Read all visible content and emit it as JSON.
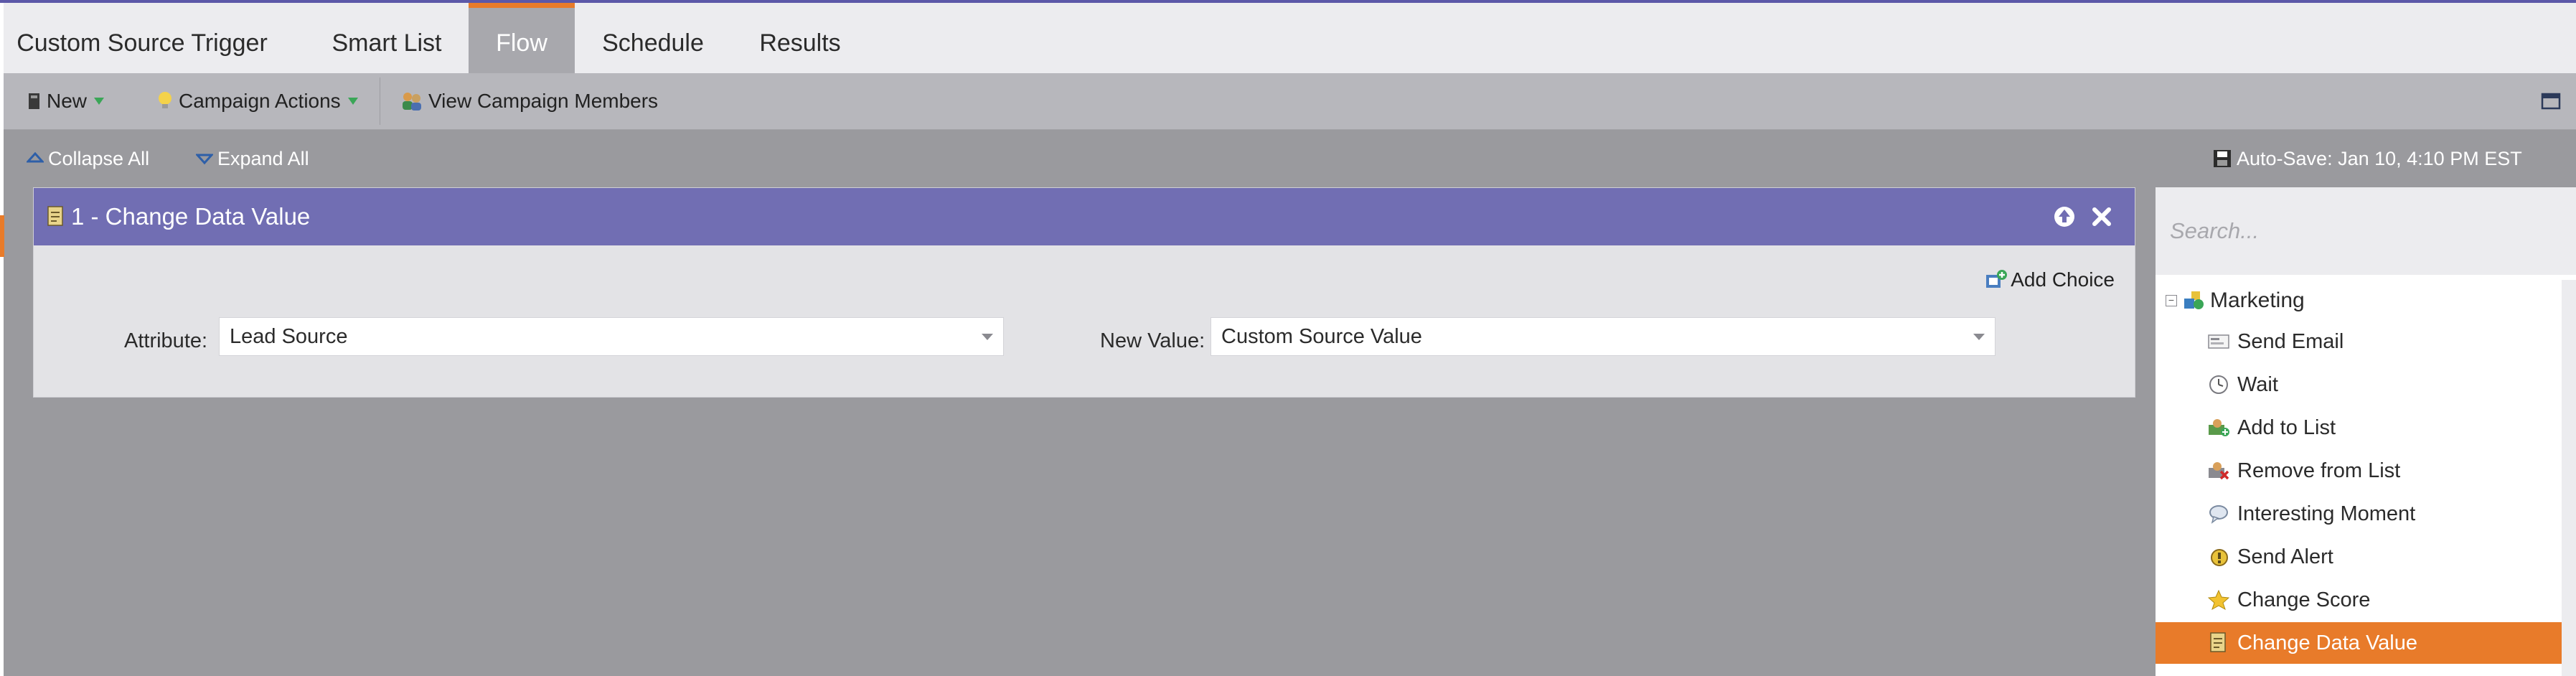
{
  "tabs": [
    {
      "label": "Custom Source Trigger",
      "active": false
    },
    {
      "label": "Smart List",
      "active": false
    },
    {
      "label": "Flow",
      "active": true
    },
    {
      "label": "Schedule",
      "active": false
    },
    {
      "label": "Results",
      "active": false
    }
  ],
  "toolbar": {
    "new_label": "New",
    "campaign_actions_label": "Campaign Actions",
    "view_members_label": "View Campaign Members"
  },
  "actionbar": {
    "collapse_all": "Collapse All",
    "expand_all": "Expand All",
    "autosave": "Auto-Save: Jan 10, 4:10 PM EST"
  },
  "step": {
    "title": "1 - Change Data Value",
    "add_choice": "Add Choice",
    "attribute_label": "Attribute:",
    "attribute_value": "Lead Source",
    "new_value_label": "New Value:",
    "new_value_value": "Custom Source Value"
  },
  "palette": {
    "search_placeholder": "Search...",
    "group_label": "Marketing",
    "items": [
      {
        "label": "Send Email",
        "icon": "email-icon"
      },
      {
        "label": "Wait",
        "icon": "clock-icon"
      },
      {
        "label": "Add to List",
        "icon": "add-to-list-icon"
      },
      {
        "label": "Remove from List",
        "icon": "remove-from-list-icon"
      },
      {
        "label": "Interesting Moment",
        "icon": "speech-bubble-icon"
      },
      {
        "label": "Send Alert",
        "icon": "alert-icon"
      },
      {
        "label": "Change Score",
        "icon": "star-icon"
      },
      {
        "label": "Change Data Value",
        "icon": "data-value-icon",
        "selected": true
      }
    ]
  },
  "colors": {
    "accent_orange": "#e87b2a",
    "header_purple": "#716eb3",
    "canvas_gray": "#9a9a9e"
  }
}
